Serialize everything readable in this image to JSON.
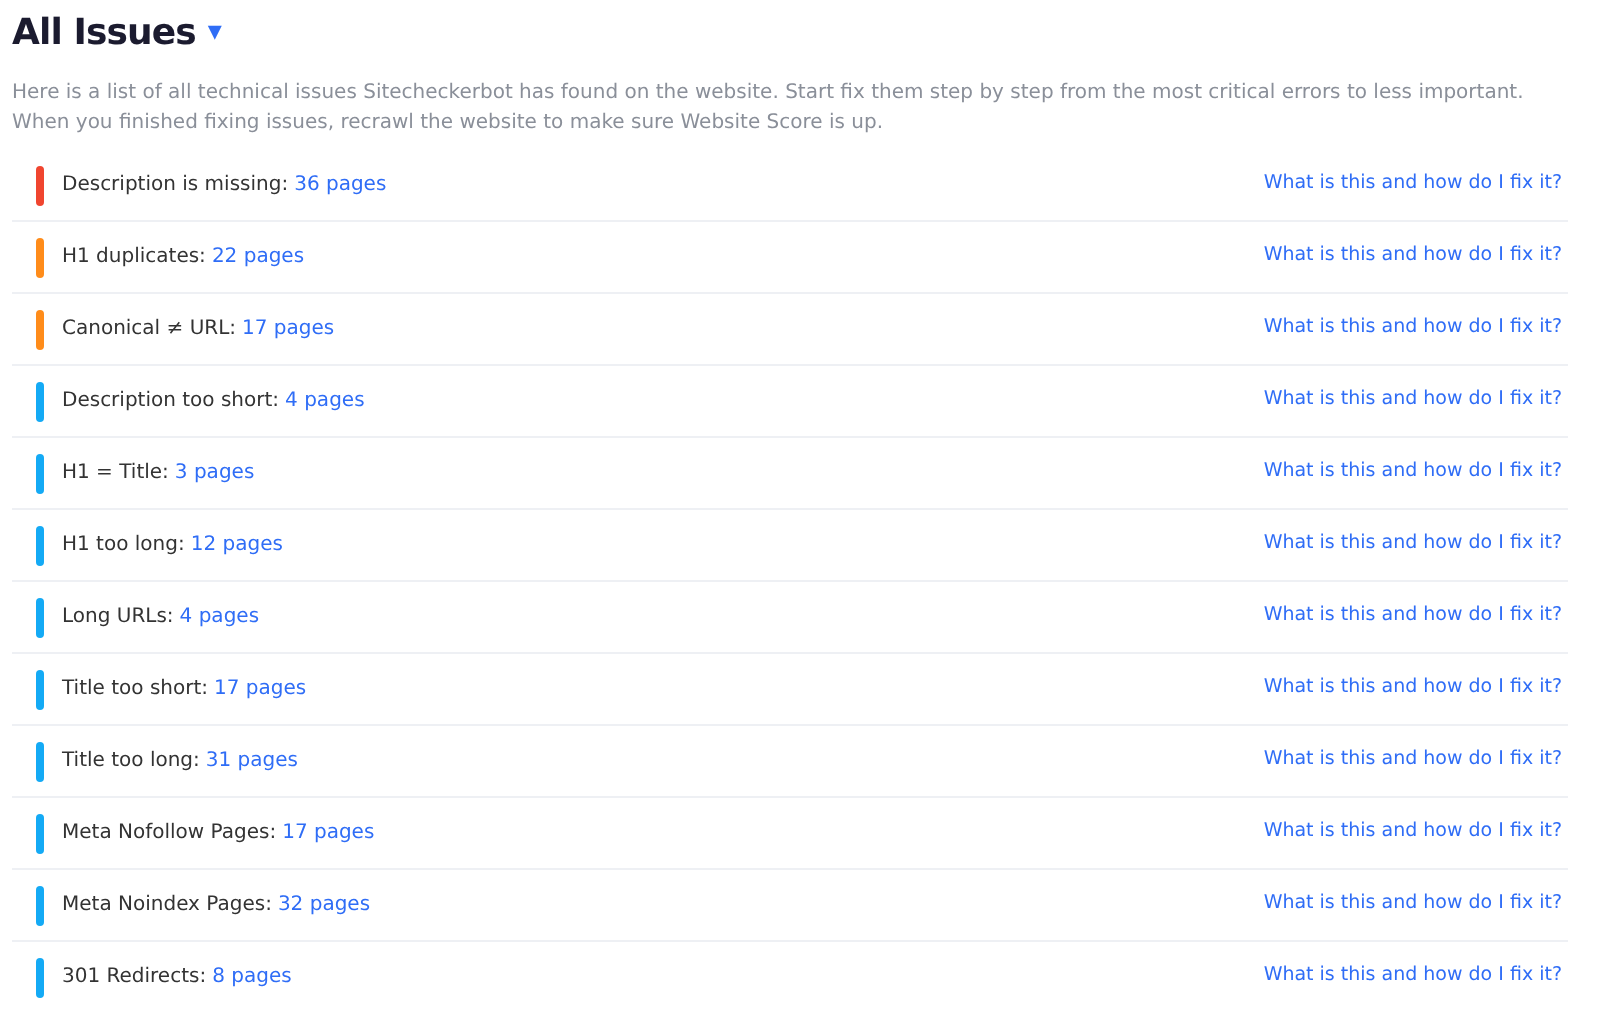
{
  "header": {
    "title": "All Issues",
    "dropdown_icon": "▾"
  },
  "intro": "Here is a list of all technical issues Sitecheckerbot has found on the website. Start fix them step by step from the most critical errors to less important. When you finished fixing issues, recrawl the website to make sure Website Score is up.",
  "issues": [
    {
      "label": "Description is missing:",
      "count": "36 pages",
      "color": "#f0452f",
      "help": "What is this and how do I fix it?"
    },
    {
      "label": "H1 duplicates:",
      "count": "22 pages",
      "color": "#ff8c1a",
      "help": "What is this and how do I fix it?"
    },
    {
      "label": "Canonical ≠ URL:",
      "count": "17 pages",
      "color": "#ff8c1a",
      "help": "What is this and how do I fix it?"
    },
    {
      "label": "Description too short:",
      "count": "4 pages",
      "color": "#14aaf5",
      "help": "What is this and how do I fix it?"
    },
    {
      "label": "H1 = Title:",
      "count": "3 pages",
      "color": "#14aaf5",
      "help": "What is this and how do I fix it?"
    },
    {
      "label": "H1 too long:",
      "count": "12 pages",
      "color": "#14aaf5",
      "help": "What is this and how do I fix it?"
    },
    {
      "label": "Long URLs:",
      "count": "4 pages",
      "color": "#14aaf5",
      "help": "What is this and how do I fix it?"
    },
    {
      "label": "Title too short:",
      "count": "17 pages",
      "color": "#14aaf5",
      "help": "What is this and how do I fix it?"
    },
    {
      "label": "Title too long:",
      "count": "31 pages",
      "color": "#14aaf5",
      "help": "What is this and how do I fix it?"
    },
    {
      "label": "Meta Nofollow Pages:",
      "count": "17 pages",
      "color": "#14aaf5",
      "help": "What is this and how do I fix it?"
    },
    {
      "label": "Meta Noindex Pages:",
      "count": "32 pages",
      "color": "#14aaf5",
      "help": "What is this and how do I fix it?"
    },
    {
      "label": "301 Redirects:",
      "count": "8 pages",
      "color": "#14aaf5",
      "help": "What is this and how do I fix it?"
    }
  ]
}
